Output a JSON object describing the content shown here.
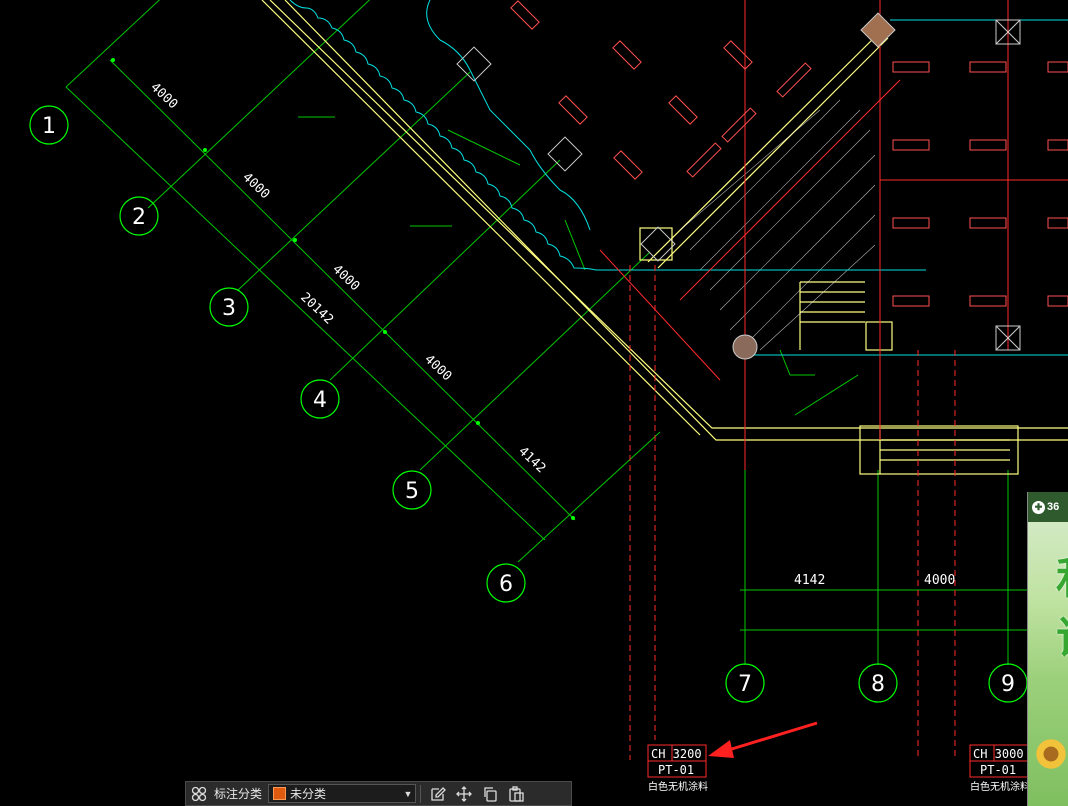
{
  "drawing": {
    "grid_bubbles": [
      "1",
      "2",
      "3",
      "4",
      "5",
      "6",
      "7",
      "8",
      "9"
    ],
    "diag_dimensions": [
      "4000",
      "4000",
      "4000",
      "4000",
      "4142"
    ],
    "diag_total": "20142",
    "horiz_dimensions": [
      "4142",
      "4000"
    ],
    "ceiling_tags": [
      {
        "height": "CH 3200",
        "code": "PT-01",
        "note": "白色无机涂料"
      },
      {
        "height": "CH 3000",
        "code": "PT-01",
        "note": "白色无机涂料"
      }
    ],
    "colors": {
      "grid": "#00ff00",
      "wall": "#ffff80",
      "red_line": "#ff2a2a",
      "ceiling": "#00ffff",
      "arrow": "#ff2020"
    }
  },
  "ad": {
    "badge": "36",
    "glyph_top": "和",
    "glyph_bottom": "议"
  },
  "toolbar": {
    "label": "标注分类",
    "select_value": "未分类",
    "icons": [
      "grid-icon",
      "edit-icon",
      "move-icon",
      "copy-icon",
      "paste-icon"
    ]
  }
}
